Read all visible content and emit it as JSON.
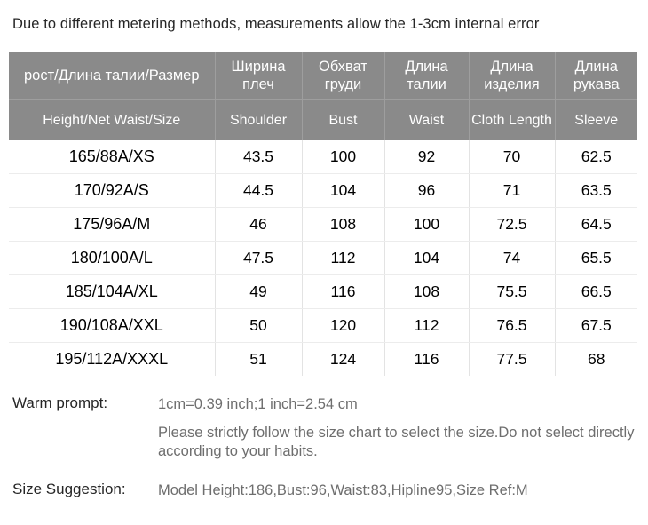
{
  "notice": "Due to different metering methods, measurements allow the 1-3cm internal error",
  "table": {
    "headers_ru": [
      "рост/Длина талии/Размер",
      "Ширина плеч",
      "Обхват груди",
      "Длина талии",
      "Длина изделия",
      "Длина рукава"
    ],
    "headers_en": [
      "Height/Net  Waist/Size",
      "Shoulder",
      "Bust",
      "Waist",
      "Cloth Length",
      "Sleeve"
    ],
    "rows": [
      {
        "size": "165/88A/XS",
        "shoulder": "43.5",
        "bust": "100",
        "waist": "92",
        "cloth_length": "70",
        "sleeve": "62.5"
      },
      {
        "size": "170/92A/S",
        "shoulder": "44.5",
        "bust": "104",
        "waist": "96",
        "cloth_length": "71",
        "sleeve": "63.5"
      },
      {
        "size": "175/96A/M",
        "shoulder": "46",
        "bust": "108",
        "waist": "100",
        "cloth_length": "72.5",
        "sleeve": "64.5"
      },
      {
        "size": "180/100A/L",
        "shoulder": "47.5",
        "bust": "112",
        "waist": "104",
        "cloth_length": "74",
        "sleeve": "65.5"
      },
      {
        "size": "185/104A/XL",
        "shoulder": "49",
        "bust": "116",
        "waist": "108",
        "cloth_length": "75.5",
        "sleeve": "66.5"
      },
      {
        "size": "190/108A/XXL",
        "shoulder": "50",
        "bust": "120",
        "waist": "112",
        "cloth_length": "76.5",
        "sleeve": "67.5"
      },
      {
        "size": "195/112A/XXXL",
        "shoulder": "51",
        "bust": "124",
        "waist": "116",
        "cloth_length": "77.5",
        "sleeve": "68"
      }
    ]
  },
  "footer": {
    "warm_prompt_label": "Warm prompt:",
    "warm_prompt_value": "1cm=0.39 inch;1 inch=2.54 cm",
    "advice_value": "Please strictly follow the size chart  to select the size.Do not select directly according to your habits.",
    "size_suggestion_label": "Size Suggestion:",
    "size_suggestion_value": "Model Height:186,Bust:96,Waist:83,Hipline95,Size Ref:M"
  },
  "colors": {
    "header_bg": "#8a8a8a",
    "header_text": "#ffffff",
    "body_text": "#000000",
    "muted_text": "#6e6e6e"
  }
}
